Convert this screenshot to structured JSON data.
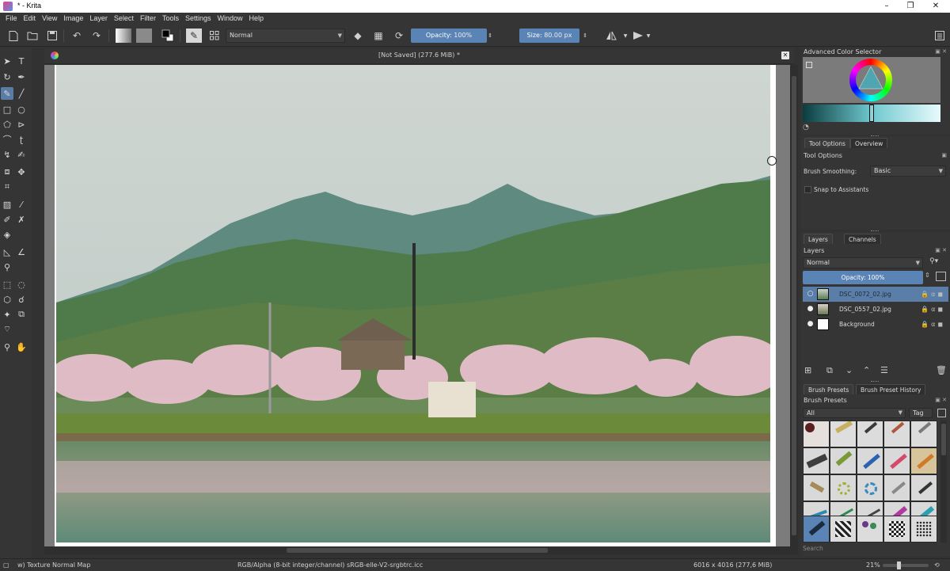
{
  "window": {
    "title": "* - Krita",
    "minimize": "–",
    "restore": "❐",
    "close": "✕"
  },
  "menu": [
    "File",
    "Edit",
    "View",
    "Image",
    "Layer",
    "Select",
    "Filter",
    "Tools",
    "Settings",
    "Window",
    "Help"
  ],
  "toolbar": {
    "blend_mode": "Normal",
    "opacity_label": "Opacity:",
    "opacity_value": "100%",
    "size_label": "Size:",
    "size_value": "80.00 px"
  },
  "document": {
    "title": "[Not Saved]  (277.6 MiB) *"
  },
  "color_selector": {
    "title": "Advanced Color Selector"
  },
  "tool_options": {
    "tabs": [
      "Tool Options",
      "Overview"
    ],
    "title": "Tool Options",
    "smoothing_label": "Brush Smoothing:",
    "smoothing_value": "Basic",
    "snap_label": "Snap to Assistants"
  },
  "layers": {
    "tabs": [
      "Layers",
      "Channels"
    ],
    "title": "Layers",
    "blend_mode": "Normal",
    "opacity_label": "Opacity:  100%",
    "items": [
      {
        "name": "DSC_0072_02.jpg",
        "selected": true
      },
      {
        "name": "DSC_0557_02.jpg",
        "selected": false
      },
      {
        "name": "Background",
        "selected": false
      }
    ]
  },
  "brush_presets": {
    "tabs": [
      "Brush Presets",
      "Brush Preset History"
    ],
    "title": "Brush Presets",
    "filter_value": "All",
    "tag_label": "Tag",
    "search_placeholder": "Search"
  },
  "status": {
    "brush_name": "w) Texture Normal Map",
    "color_info": "RGB/Alpha (8-bit integer/channel)  sRGB-elle-V2-srgbtrc.icc",
    "image_size": "6016 x 4016 (277,6 MiB)",
    "zoom": "21%"
  },
  "colors": {
    "accent": "#5b84b6",
    "panel": "#353535"
  }
}
